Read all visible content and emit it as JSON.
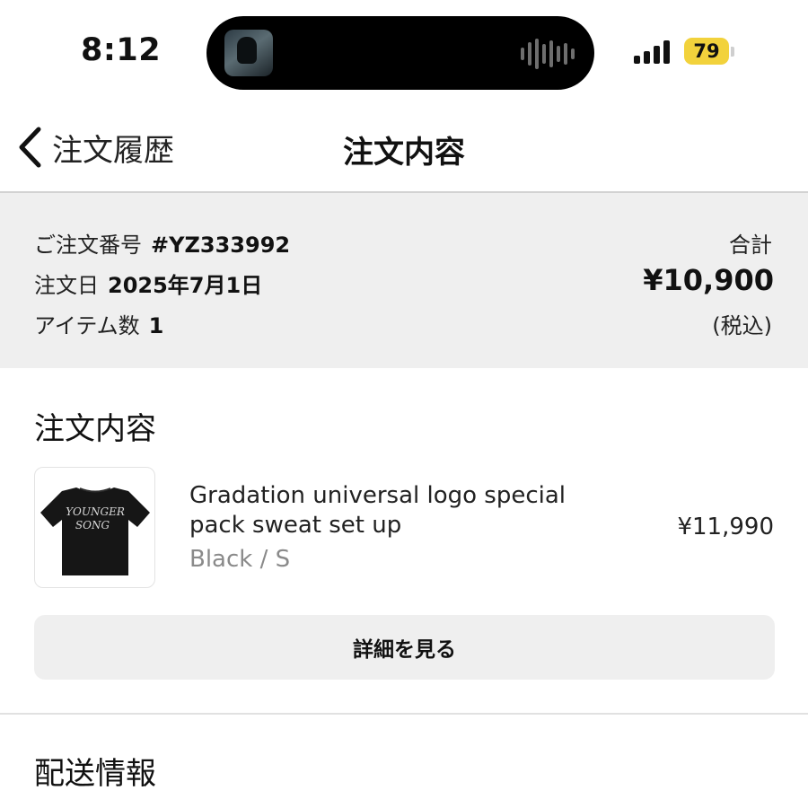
{
  "status_bar": {
    "time": "8:12",
    "battery_level": "79",
    "battery_color": "#f2d23c"
  },
  "nav": {
    "back_label": "注文履歴",
    "title": "注文内容"
  },
  "summary": {
    "order_number_label": "ご注文番号",
    "order_number": "#YZ333992",
    "order_date_label": "注文日",
    "order_date": "2025年7月1日",
    "item_count_label": "アイテム数",
    "item_count": "1",
    "total_label": "合計",
    "total_amount": "¥10,900",
    "tax_note": "(税込)"
  },
  "order_contents": {
    "section_title": "注文内容",
    "items": [
      {
        "name": "Gradation universal logo special pack sweat set up",
        "variant": "Black / S",
        "price": "¥11,990",
        "thumbnail_icon": "black-tshirt-image"
      }
    ],
    "details_button_label": "詳細を見る"
  },
  "shipping": {
    "section_title": "配送情報"
  }
}
